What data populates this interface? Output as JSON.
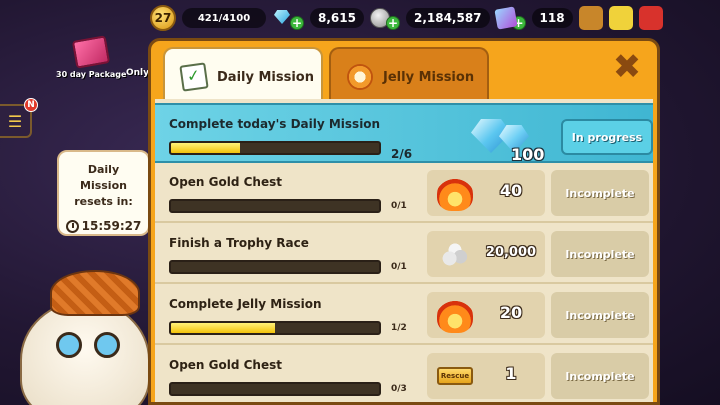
{
  "topbar": {
    "level": "27",
    "xp": "421/4100",
    "crystals": "8,615",
    "coins": "2,184,587",
    "boxes": "118",
    "plus_label": "+"
  },
  "side": {
    "package_label": "30 day Package",
    "only_label": "Only",
    "menu_badge": "N",
    "reset_title_line1": "Daily Mission",
    "reset_title_line2": "resets in:",
    "reset_time": "15:59:27"
  },
  "tabs": [
    {
      "label": "Daily Mission",
      "icon": "clipboard-icon",
      "active": true
    },
    {
      "label": "Jelly Mission",
      "icon": "jelly-icon",
      "active": false
    }
  ],
  "close_label": "✖",
  "summary": {
    "title": "Complete today's Daily Mission",
    "progress_text": "2/6",
    "progress": 0.33,
    "reward_icon": "crystal-icon",
    "reward_amount": "100",
    "status": "In progress"
  },
  "missions": [
    {
      "name": "Open Gold Chest",
      "progress_text": "0/1",
      "progress": 0.0,
      "reward_icon": "fire-icon",
      "reward_amount": "40",
      "status": "Incomplete"
    },
    {
      "name": "Finish a Trophy Race",
      "progress_text": "0/1",
      "progress": 0.0,
      "reward_icon": "coins-icon",
      "reward_amount": "20,000",
      "status": "Incomplete"
    },
    {
      "name": "Complete Jelly Mission",
      "progress_text": "1/2",
      "progress": 0.5,
      "reward_icon": "fire-icon",
      "reward_amount": "20",
      "status": "Incomplete"
    },
    {
      "name": "Open Gold Chest",
      "progress_text": "0/3",
      "progress": 0.0,
      "reward_icon": "ticket-icon",
      "reward_icon_text": "Rescue",
      "reward_amount": "1",
      "status": "Incomplete"
    }
  ],
  "colors": {
    "dialog_orange": "#f6a51c",
    "summary_teal": "#3fb6d2",
    "progress_yellow": "#f2c20a"
  }
}
